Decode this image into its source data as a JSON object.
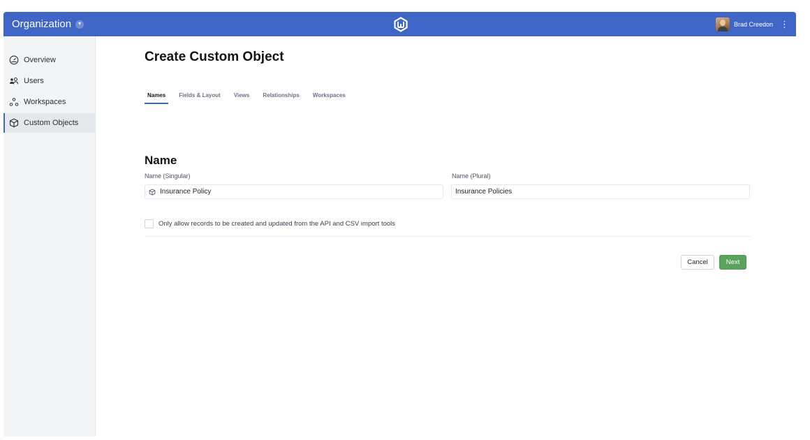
{
  "header": {
    "org_label": "Organization",
    "user_name": "Brad Creedon",
    "brand_color": "#3f66c7"
  },
  "sidebar": {
    "items": [
      {
        "label": "Overview",
        "icon": "gauge-icon"
      },
      {
        "label": "Users",
        "icon": "users-icon"
      },
      {
        "label": "Workspaces",
        "icon": "workspaces-icon"
      },
      {
        "label": "Custom Objects",
        "icon": "cube-icon",
        "active": true
      }
    ]
  },
  "main": {
    "title": "Create Custom Object",
    "tabs": [
      {
        "label": "Names",
        "active": true
      },
      {
        "label": "Fields & Layout"
      },
      {
        "label": "Views"
      },
      {
        "label": "Relationships"
      },
      {
        "label": "Workspaces"
      }
    ],
    "section_title": "Name",
    "singular_label": "Name (Singular)",
    "singular_value": "Insurance Policy",
    "plural_label": "Name (Plural)",
    "plural_value": "Insurance Policies",
    "checkbox_label": "Only allow records to be created and updated from the API and CSV import tools",
    "cancel_label": "Cancel",
    "next_label": "Next",
    "next_color": "#59a35b"
  }
}
